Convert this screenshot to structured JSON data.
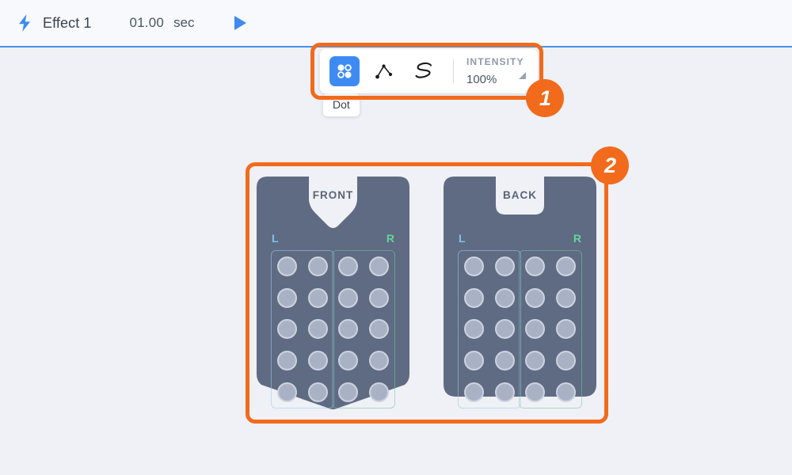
{
  "header": {
    "bolt_icon": "lightning-bolt-icon",
    "effect_name": "Effect 1",
    "duration_value": "01.00",
    "duration_unit": "sec",
    "play_icon": "play-icon"
  },
  "toolbar": {
    "tools": [
      {
        "id": "dot",
        "icon": "four-dots-icon",
        "label": "Dot",
        "active": true
      },
      {
        "id": "path",
        "icon": "path-line-icon",
        "label": "Path",
        "active": false
      },
      {
        "id": "free",
        "icon": "freehand-s-icon",
        "label": "Freehand",
        "active": false
      }
    ],
    "intensity_label": "INTENSITY",
    "intensity_value": "100%",
    "intensity_caret_icon": "caret-resize-icon",
    "tooltip": "Dot"
  },
  "highlights": [
    {
      "id": "toolbar-highlight",
      "badge": "1"
    },
    {
      "id": "vest-highlight",
      "badge": "2"
    }
  ],
  "badges": {
    "one": "1",
    "two": "2"
  },
  "vests": [
    {
      "id": "front",
      "title": "FRONT",
      "neck": "v-neck",
      "left_label": "L",
      "right_label": "R",
      "rows": 5,
      "cols": 2,
      "motor_count": 20
    },
    {
      "id": "back",
      "title": "BACK",
      "neck": "crew-neck",
      "left_label": "L",
      "right_label": "R",
      "rows": 5,
      "cols": 2,
      "motor_count": 20
    }
  ],
  "colors": {
    "accent_blue": "#3d8bf2",
    "highlight_orange": "#f26a1b",
    "vest_body": "#5f6b82",
    "motor": "#a9b2c4",
    "left_label": "#7fc0f0",
    "right_label": "#64d49c",
    "header_bg": "#f7f9fc",
    "page_bg": "#eff1f6"
  }
}
